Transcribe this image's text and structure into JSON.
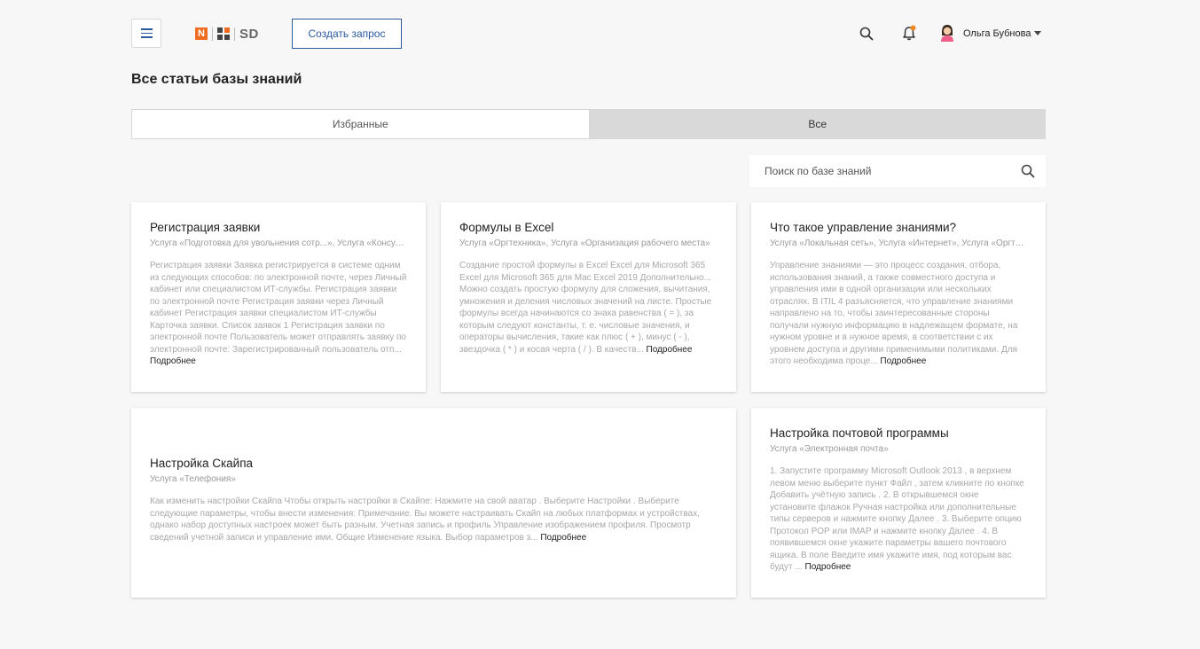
{
  "header": {
    "logo_letter": "N",
    "logo_text": "SD",
    "create_button": "Создать запрос",
    "user_name": "Ольга Бубнова",
    "accent": "#2b5aa0",
    "logo_orange": "#ef6b1f"
  },
  "page_title": "Все статьи базы знаний",
  "tabs": [
    {
      "label": "Избранные",
      "active": false
    },
    {
      "label": "Все",
      "active": true
    }
  ],
  "search": {
    "placeholder": "Поиск по базе знаний",
    "value": ""
  },
  "more_label": "Подробнее",
  "articles": [
    {
      "title": "Регистрация заявки",
      "services": "Услуга «Подготовка для увольнения сотр...», Услуга «Консультация»",
      "excerpt": "Регистрация заявки Заявка регистрируется в системе одним из следующих способов: по электронной почте, через Личный кабинет или специалистом ИТ-службы. Регистрация заявки по электронной почте Регистрация заявки через Личный кабинет Регистрация заявки специалистом ИТ-службы Карточка заявки. Список заявок 1 Регистрация заявки по электронной почте Пользователь может отправлять заявку по электронной почте: Зарегистрированный пользователь отп..."
    },
    {
      "title": "Формулы в Excel",
      "services": "Услуга «Оргтехника», Услуга «Организация рабочего места»",
      "excerpt": "Создание простой формулы в Excel Excel для Microsoft 365 Excel для Microsoft 365 для Mac Excel 2019 Дополнительно... Можно создать простую формулу для сложения, вычитания, умножения и деления числовых значений на листе. Простые формулы всегда начинаются со знака равенства ( = ), за которым следуют константы, т. е. числовые значения, и операторы вычисления, такие как плюс ( + ), минус ( - ), звездочка ( * ) и косая черта ( / ). В качеств..."
    },
    {
      "title": "Что такое управление знаниями?",
      "services": "Услуга «Локальная сеть», Услуга «Интернет», Услуга «Оргтехника»",
      "excerpt": "Управление знаниями — это процесс создания, отбора, использования знаний, а также совместного доступа и управления ими в одной организации или нескольких отраслях. В ITIL 4 разъясняется, что управление знаниями направлено на то, чтобы заинтересованные стороны получали нужную информацию в надлежащем формате, на нужном уровне и в нужное время, в соответствии с их уровнем доступа и другими применимыми политиками. Для этого необходима проце..."
    },
    {
      "title": "Настройка Скайпа",
      "services": "Услуга «Телефония»",
      "excerpt": "Как изменить настройки Скайпа Чтобы открыть настройки в Скайпе: Нажмите на свой аватар . Выберите Настройки . Выберите следующие параметры, чтобы внести изменения: Примечание. Вы можете настраивать Скайп на любых платформах и устройствах, однако набор доступных настроек может быть разным. Учетная запись и профиль Управление изображением профиля. Просмотр сведений учетной записи и управление ими. Общие Изменение языка. Выбор параметров з..."
    },
    {
      "title": "Настройка почтовой программы",
      "services": "Услуга «Электронная почта»",
      "excerpt": "1. Запустите программу Microsoft Outlook 2013 , в верхнем левом меню выберите пункт Файл , затем кликните по кнопке Добавить учётную запись . 2. В открывшемся окне установите флажок Ручная настройка или дополнительные типы серверов и нажмите кнопку Далее . 3. Выберите опцию Протокол POP или IMAP и нажмите кнопку Далее . 4. В появившемся окне укажите параметры вашего почтового ящика. В поле Введите имя укажите имя, под которым вас будут ..."
    }
  ]
}
